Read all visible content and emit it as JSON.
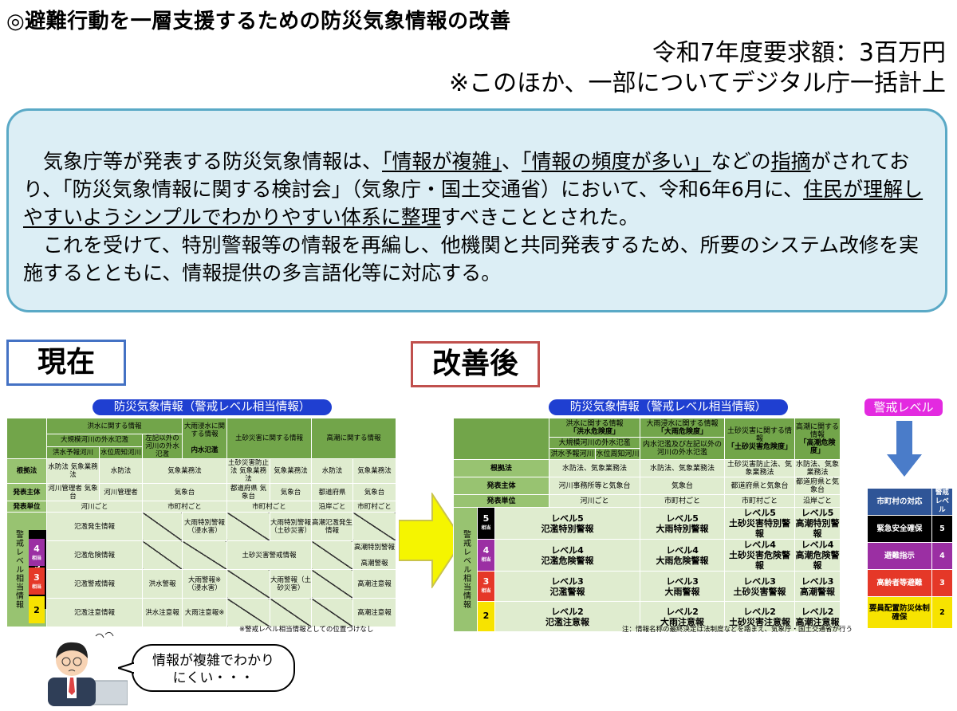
{
  "title": "◎避難行動を一層支援するための防災気象情報の改善",
  "budget": {
    "line1": "令和7年度要求額：3百万円",
    "line2": "※このほか、一部についてデジタル庁一括計上"
  },
  "summary": {
    "p1_a": "　気象庁等が発表する防災気象情報は、",
    "p1_u1": "「情報が複雑」",
    "p1_b": "、",
    "p1_u2": "「情報の頻度が多い」",
    "p1_c": "などの",
    "p1_u3": "指摘",
    "p1_d": "がされており、「防災気象情報に関する検討会」（気象庁・国土交通省）において、令和6年6月に、",
    "p1_u4": "住民が理解しやすいようシンプルでわかりやすい体系に整理",
    "p1_e": "すべきこととされた。",
    "p2": "　これを受けて、特別警報等の情報を再編し、他機関と共同発表するため、所要のシステム改修を実施するとともに、情報提供の多言語化等に対応する。"
  },
  "labels": {
    "current": "現在",
    "improved": "改善後"
  },
  "current_table": {
    "banner": "防災気象情報（警戒レベル相当情報）",
    "h_flood": "洪水に関する情報",
    "h_large_river": "大規模河川の外水氾濫",
    "h_other_river": "左記以外の河川の外水氾濫",
    "h_forecast": "洪水予報河川",
    "h_water_level": "水位周知河川",
    "h_heavy_rain": "大雨浸水に関する情報",
    "h_inland": "内水氾濫",
    "h_sediment": "土砂災害に関する情報",
    "h_tide": "高潮に関する情報",
    "r_law": "根拠法",
    "law": [
      "水防法 気象業務法",
      "水防法",
      "気象業務法",
      "土砂災害防止法 気象業務法",
      "気象業務法",
      "水防法",
      "気象業務法"
    ],
    "r_issuer": "発表主体",
    "issuer": [
      "河川管理者 気象台",
      "河川管理者",
      "気象台",
      "都道府県 気象台",
      "気象台",
      "都道府県",
      "気象台"
    ],
    "r_unit": "発表単位",
    "unit": [
      "河川ごと",
      "市町村ごと",
      "市町村ごと",
      "沿岸ごと",
      "市町村ごと"
    ],
    "side_label": "警戒レベル相当情報",
    "lv5": "5",
    "lv4": "4",
    "lv3": "3",
    "lv2": "2",
    "equiv": "相当",
    "l5": [
      "氾濫発生情報",
      "大雨特別警報（浸水害）",
      "大雨特別警報（土砂災害）",
      "高潮氾濫発生情報"
    ],
    "l4": [
      "氾濫危険情報",
      "土砂災害警戒情報",
      "高潮特別警報",
      "高潮警報"
    ],
    "l3": [
      "氾濫警戒情報",
      "洪水警報",
      "大雨警報※（浸水害）",
      "大雨警報（土砂災害）",
      "高潮注意報"
    ],
    "l2": [
      "氾濫注意情報",
      "洪水注意報",
      "大雨注意報※",
      "高潮注意報"
    ],
    "note": "※警戒レベル相当情報としての位置づけなし"
  },
  "new_table": {
    "banner": "防災気象情報（警戒レベル相当情報）",
    "cols": [
      {
        "h1": "洪水に関する情報",
        "h2": "「洪水危険度」"
      },
      {
        "h1": "大雨浸水に関する情報",
        "h2": "「大雨危険度」"
      },
      {
        "h1": "土砂災害に関する情報",
        "h2": "「土砂災害危険度」"
      },
      {
        "h1": "高潮に関する情報",
        "h2": "「高潮危険度」"
      }
    ],
    "sub_large": "大規模河川の外水氾濫",
    "sub_forecast": "洪水予報河川",
    "sub_water": "水位周知河川",
    "sub_inland": "内水氾濫及び左記以外の河川の外水氾濫",
    "r_law": "根拠法",
    "law": [
      "水防法、気象業務法",
      "水防法、気象業務法",
      "土砂災害防止法、気象業務法",
      "水防法、気象業務法"
    ],
    "r_issuer": "発表主体",
    "issuer": [
      "河川事務所等と気象台",
      "気象台",
      "都道府県と気象台",
      "都道府県と気象台"
    ],
    "r_unit": "発表単位",
    "unit": [
      "河川ごと",
      "市町村ごと",
      "市町村ごと",
      "沿岸ごと"
    ],
    "side_label": "警戒レベル相当情報",
    "rows": [
      {
        "lv": "5",
        "cells": [
          [
            "レベル5",
            "氾濫特別警報"
          ],
          [
            "レベル5",
            "大雨特別警報"
          ],
          [
            "レベル5",
            "土砂災害特別警報"
          ],
          [
            "レベル5",
            "高潮特別警報"
          ]
        ]
      },
      {
        "lv": "4",
        "cells": [
          [
            "レベル4",
            "氾濫危険警報"
          ],
          [
            "レベル4",
            "大雨危険警報"
          ],
          [
            "レベル4",
            "土砂災害危険警報"
          ],
          [
            "レベル4",
            "高潮危険警報"
          ]
        ]
      },
      {
        "lv": "3",
        "cells": [
          [
            "レベル3",
            "氾濫警報"
          ],
          [
            "レベル3",
            "大雨警報"
          ],
          [
            "レベル3",
            "土砂災害警報"
          ],
          [
            "レベル3",
            "高潮警報"
          ]
        ]
      },
      {
        "lv": "2",
        "cells": [
          [
            "レベル2",
            "氾濫注意報"
          ],
          [
            "レベル2",
            "大雨注意報"
          ],
          [
            "レベル2",
            "土砂災害注意報"
          ],
          [
            "レベル2",
            "高潮注意報"
          ]
        ]
      }
    ],
    "equiv": "相当",
    "note": "注：情報名称の最終決定は法制度などを踏まえ、気象庁・国土交通省が行う"
  },
  "level_table": {
    "banner": "警戒レベル",
    "h_action": "市町村の対応",
    "h_level": "警戒レベル",
    "rows": [
      {
        "action": "緊急安全確保",
        "level": "5"
      },
      {
        "action": "避難指示",
        "level": "4"
      },
      {
        "action": "高齢者等避難",
        "level": "3"
      },
      {
        "action": "要員配置防災体制確保",
        "level": "2"
      }
    ]
  },
  "bubble": {
    "text1": "情報が複雑でわかり",
    "text2": "にくい・・・"
  }
}
